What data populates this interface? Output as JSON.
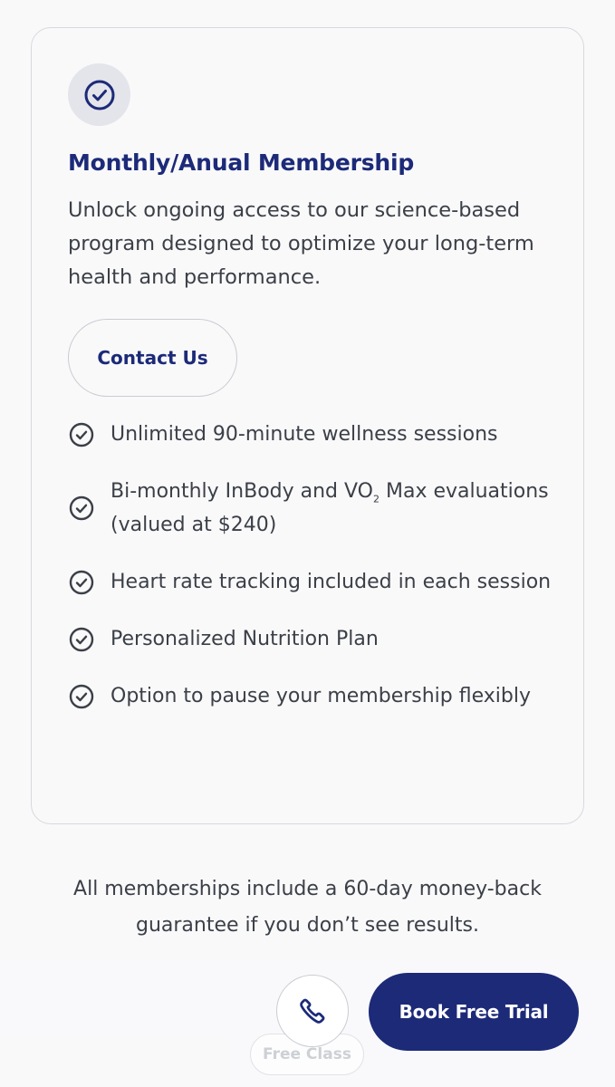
{
  "card": {
    "icon": "check-circle-icon",
    "title": "Monthly/Anual Membership",
    "description": "Unlock ongoing access to our science-based program designed to optimize your long-term health and performance.",
    "contact_label": "Contact Us",
    "features": [
      {
        "text": "Unlimited 90-minute wellness sessions"
      },
      {
        "text_before": "Bi-monthly InBody and VO",
        "subscript": "2",
        "text_after": " Max evaluations (valued at $240)"
      },
      {
        "text": "Heart rate tracking included in each session"
      },
      {
        "text": "Personalized Nutrition Plan"
      },
      {
        "text": "Option to pause your membership flexibly"
      }
    ]
  },
  "guarantee_text": "All memberships include a 60-day money-back guarantee if you don’t see results.",
  "bottom_bar": {
    "call_icon": "phone-icon",
    "free_class_label": "Free Class",
    "book_trial_label": "Book Free Trial"
  },
  "colors": {
    "brand_navy": "#1c2a78",
    "text": "#3b3f47",
    "background": "#f9f9fa",
    "border": "#d6d9de"
  }
}
